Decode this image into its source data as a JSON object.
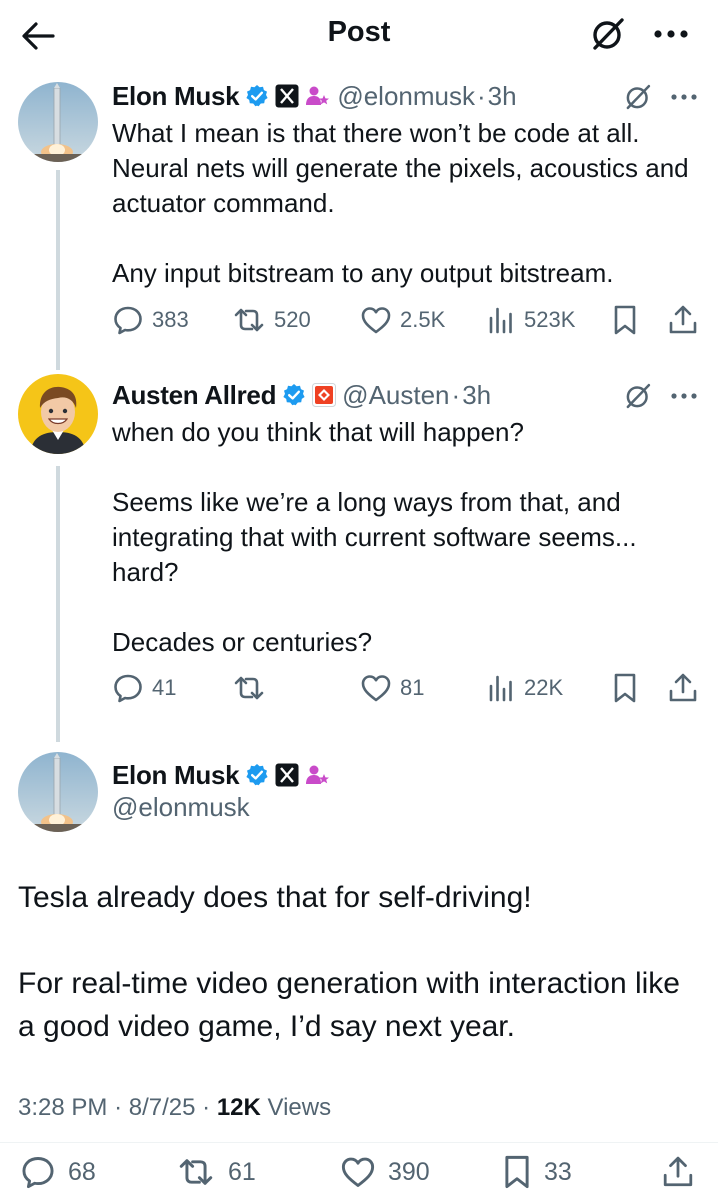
{
  "header": {
    "title": "Post"
  },
  "replies": [
    {
      "author_name": "Elon Musk",
      "handle": "@elonmusk",
      "time": "3h",
      "text": "What I mean is that there won’t be code at all. Neural nets will generate the pixels, acoustics and actuator command.\n\nAny input bitstream to any output bitstream.",
      "stats": {
        "replies": "383",
        "reposts": "520",
        "likes": "2.5K",
        "views": "523K"
      }
    },
    {
      "author_name": "Austen Allred",
      "handle": "@Austen",
      "time": "3h",
      "text": "when do you think that will happen?\n\nSeems like we’re a long ways from that, and integrating that with current software seems... hard?\n\nDecades or centuries?",
      "stats": {
        "replies": "41",
        "reposts": "",
        "likes": "81",
        "views": "22K"
      }
    }
  ],
  "main_post": {
    "author_name": "Elon Musk",
    "handle": "@elonmusk",
    "text": "Tesla already does that for self-driving!\n\nFor real-time video generation with interaction like a good video game, I’d say next year.",
    "time": "3:28 PM",
    "date": "8/7/25",
    "views_count": "12K",
    "views_label": "Views",
    "stats": {
      "replies": "68",
      "reposts": "61",
      "likes": "390",
      "bookmarks": "33"
    }
  },
  "colors": {
    "text": "#0f1419",
    "muted": "#536471",
    "verified": "#1d9bf0",
    "thread_line": "#cfd9de"
  }
}
